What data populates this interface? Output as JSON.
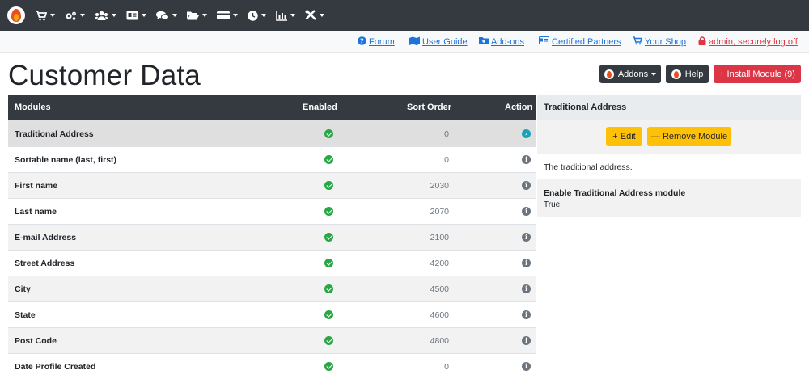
{
  "nav": {
    "icons": [
      "cart-icon",
      "gears-icon",
      "users-icon",
      "id-card-icon",
      "comments-icon",
      "folder-icon",
      "credit-card-icon",
      "clock-icon",
      "bar-chart-icon",
      "tools-icon"
    ]
  },
  "links": {
    "forum": "Forum",
    "user_guide": "User Guide",
    "addons": "Add-ons",
    "partners": "Certified Partners",
    "shop": "Your Shop",
    "logoff": "admin, securely log off"
  },
  "page": {
    "title": "Customer Data"
  },
  "buttons": {
    "addons": "Addons",
    "help": "Help",
    "install": "+ Install Module (9)"
  },
  "table": {
    "headers": {
      "modules": "Modules",
      "enabled": "Enabled",
      "sort_order": "Sort Order",
      "action": "Action"
    },
    "rows": [
      {
        "name": "Traditional Address",
        "sort": "0",
        "action": "go"
      },
      {
        "name": "Sortable name (last, first)",
        "sort": "0",
        "action": "info"
      },
      {
        "name": "First name",
        "sort": "2030",
        "action": "info"
      },
      {
        "name": "Last name",
        "sort": "2070",
        "action": "info"
      },
      {
        "name": "E-mail Address",
        "sort": "2100",
        "action": "info"
      },
      {
        "name": "Street Address",
        "sort": "4200",
        "action": "info"
      },
      {
        "name": "City",
        "sort": "4500",
        "action": "info"
      },
      {
        "name": "State",
        "sort": "4600",
        "action": "info"
      },
      {
        "name": "Post Code",
        "sort": "4800",
        "action": "info"
      },
      {
        "name": "Date Profile Created",
        "sort": "0",
        "action": "info"
      }
    ]
  },
  "panel": {
    "title": "Traditional Address",
    "edit_label": "+ Edit",
    "remove_label": "— Remove Module",
    "description": "The traditional address.",
    "field_label": "Enable Traditional Address module",
    "field_value": "True"
  },
  "colors": {
    "nav": "#343a40",
    "enabled": "#28a745",
    "install": "#dc3545",
    "warning": "#ffc107",
    "link": "#1e73d8"
  }
}
